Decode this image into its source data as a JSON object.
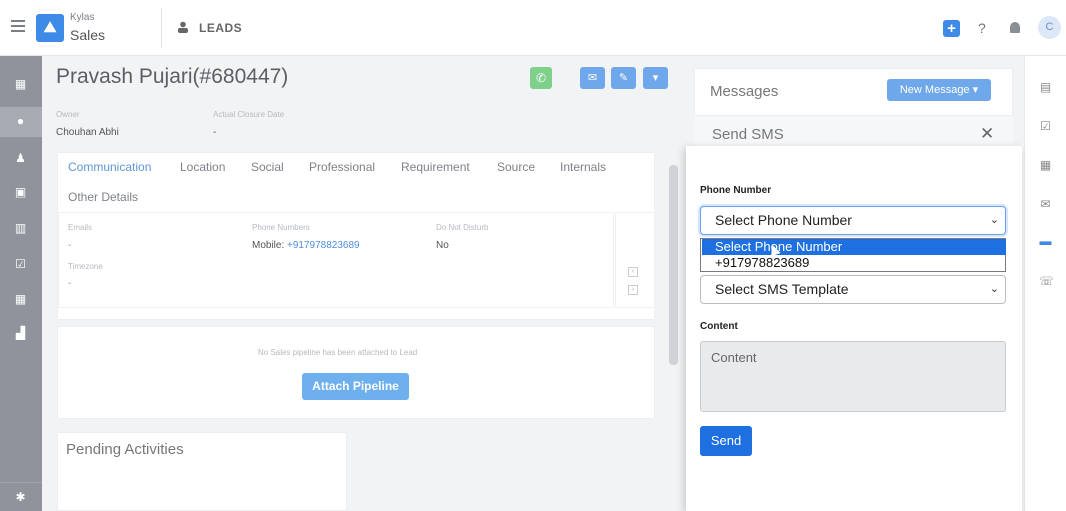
{
  "app": {
    "brand_top": "Kylas",
    "brand_main": "Sales",
    "module": "LEADS",
    "user_initial": "C"
  },
  "lead": {
    "title": "Pravash Pujari(#680447)",
    "owner_label": "Owner",
    "owner_value": "Chouhan Abhi",
    "closure_label": "Actual Closure Date",
    "closure_value": "-"
  },
  "tabs": [
    "Communication",
    "Location",
    "Social",
    "Professional",
    "Requirement",
    "Source",
    "Internals",
    "Other Details"
  ],
  "communication": {
    "emails_label": "Emails",
    "emails_value": "-",
    "phones_label": "Phone Numbers",
    "phone_prefix": "Mobile:",
    "phone_value": "+917978823689",
    "dnd_label": "Do Not Disturb",
    "dnd_value": "No",
    "timezone_label": "Timezone",
    "timezone_value": "-"
  },
  "pipeline": {
    "empty_text": "No Sales pipeline has been attached to Lead",
    "attach_label": "Attach Pipeline"
  },
  "pending": {
    "title": "Pending Activities"
  },
  "messages": {
    "title": "Messages",
    "new_button": "New Message"
  },
  "sms": {
    "title": "Send SMS",
    "phone_label": "Phone Number",
    "phone_select_value": "Select Phone Number",
    "options": [
      "Select Phone Number",
      "+917978823689"
    ],
    "template_value": "Select SMS Template",
    "content_label": "Content",
    "content_placeholder": "Content",
    "send_label": "Send"
  },
  "colors": {
    "primary": "#1e6fe0",
    "accent": "#6ea7ea",
    "whatsapp": "#7fd08b",
    "sidebar": "#8e939c"
  }
}
